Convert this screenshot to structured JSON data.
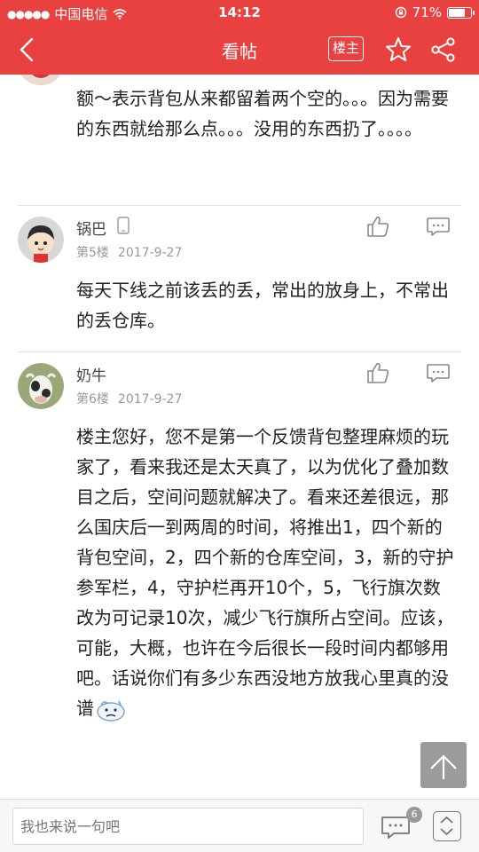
{
  "status_bar": {
    "carrier": "中国电信",
    "time": "14:12",
    "battery": "71%"
  },
  "header": {
    "title": "看帖",
    "louzhu_label": "楼主"
  },
  "posts": [
    {
      "text": "额～表示背包从来都留着两个空的。。。因为需要的东西就给那么点。。。没用的东西扔了。。。。"
    },
    {
      "username": "锅巴",
      "floor": "第5楼",
      "date": "2017-9-27",
      "text": "每天下线之前该丢的丢，常出的放身上，不常出的丢仓库。"
    },
    {
      "username": "奶牛",
      "floor": "第6楼",
      "date": "2017-9-27",
      "text": "楼主您好，您不是第一个反馈背包整理麻烦的玩家了，看来我还是太天真了，以为优化了叠加数目之后，空间问题就解决了。看来还差很远，那么国庆后一到两周的时间，将推出1，四个新的背包空间，2，四个新的仓库空间，3，新的守护参军栏，4，守护栏再开10个，5，飞行旗次数改为可记录10次，减少飞行旗所占空间。应该，可能，大概，也许在今后很长一段时间内都够用吧。话说你们有多少东西没地方放我心里真的没谱"
    }
  ],
  "bottom_bar": {
    "reply_placeholder": "我也来说一句吧",
    "comment_count": "6"
  },
  "colors": {
    "brand_red": "#e8413f",
    "divider": "#e3e3e3",
    "meta_gray": "#999999"
  },
  "icons": [
    "wifi-icon",
    "back-icon",
    "star-icon",
    "share-icon",
    "phone-icon",
    "like-icon",
    "reply-icon",
    "comment-icon",
    "scroll-top-icon",
    "emoji-icon"
  ]
}
